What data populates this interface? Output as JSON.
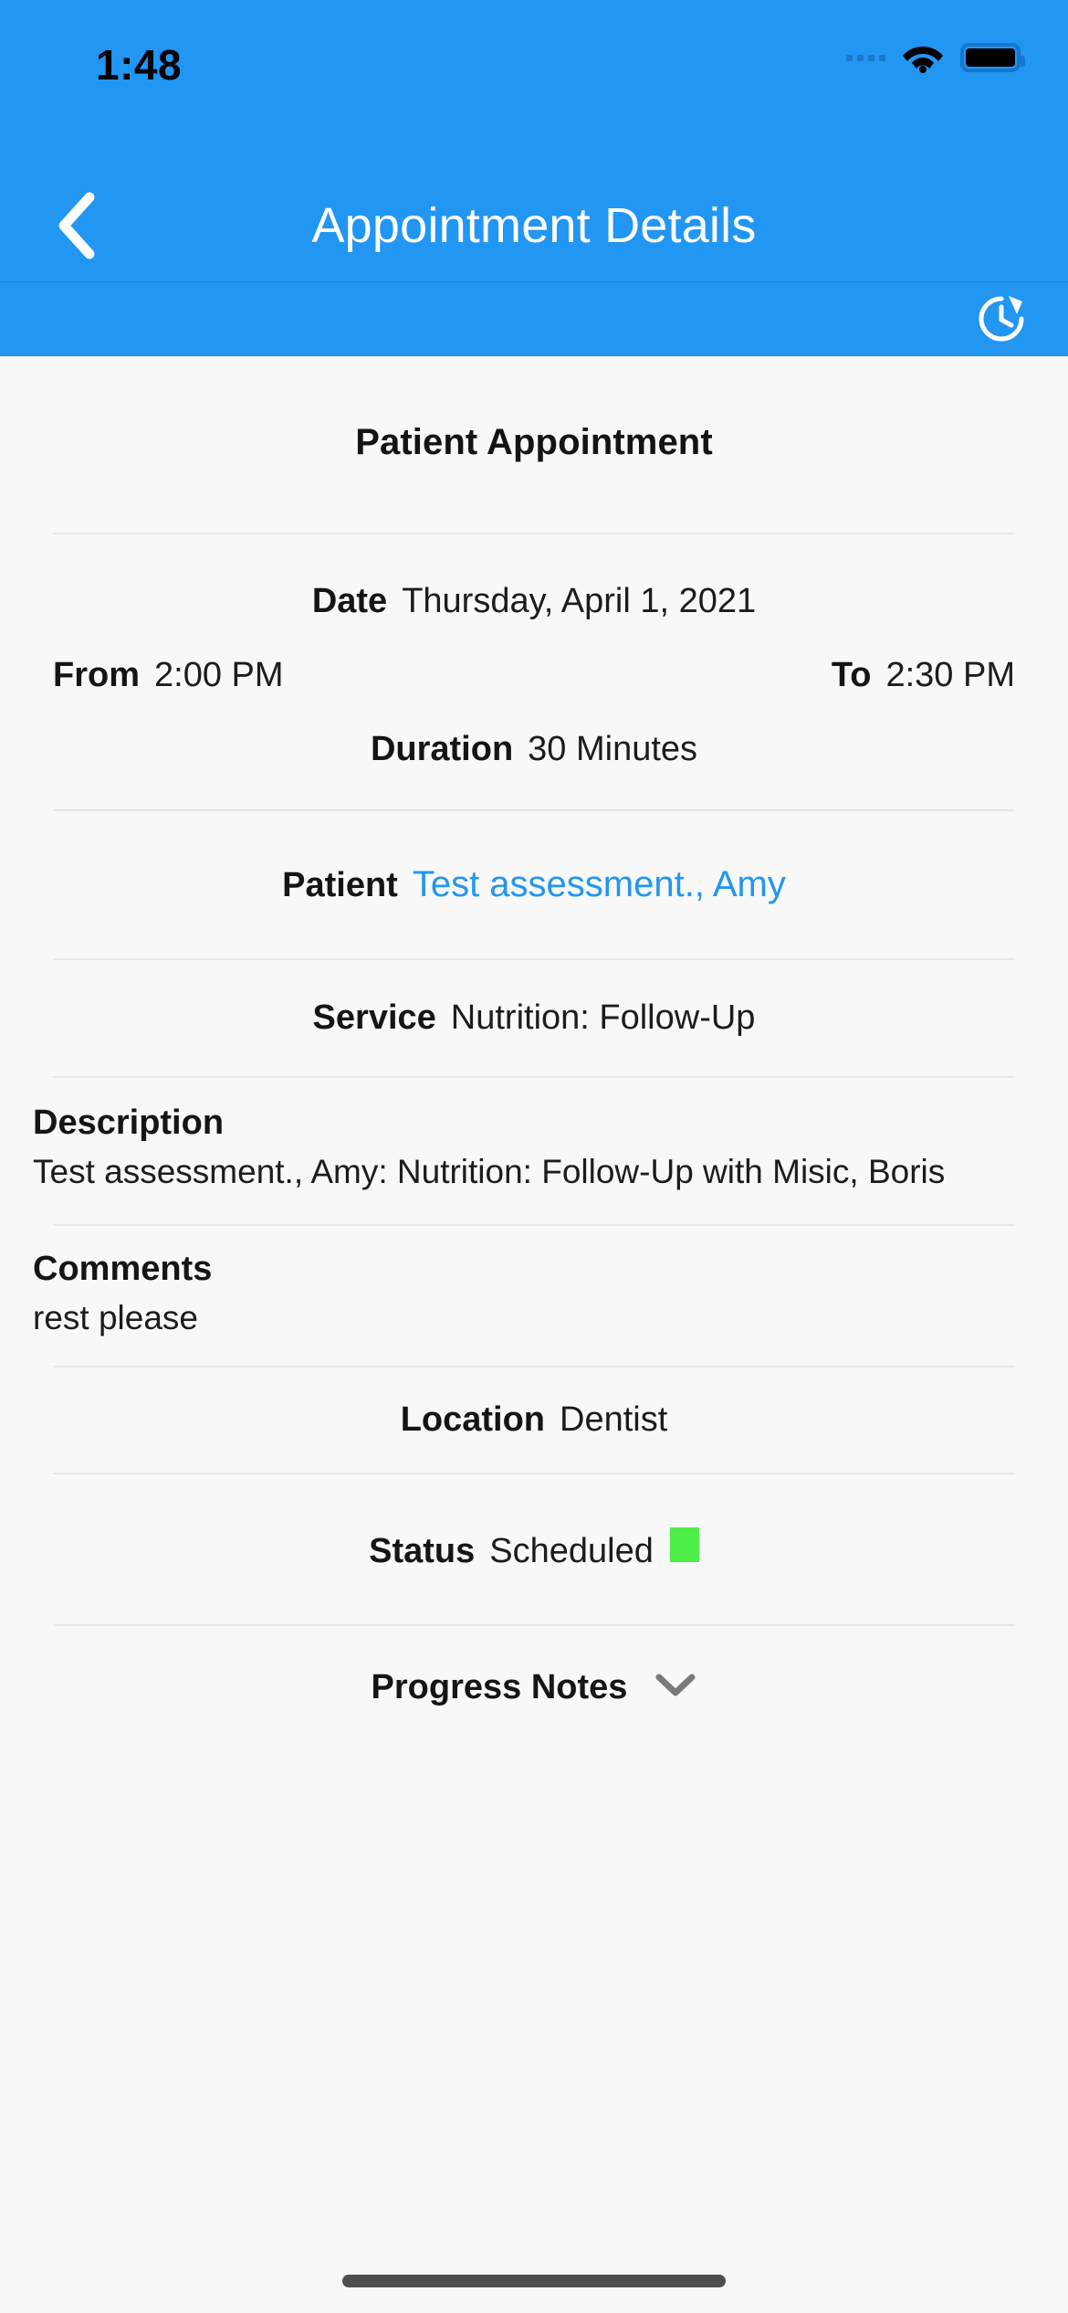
{
  "status_bar": {
    "time": "1:48",
    "icons": [
      "signal-dots-icon",
      "wifi-icon",
      "battery-icon"
    ]
  },
  "nav_bar": {
    "back_icon": "chevron-left-icon",
    "title": "Appointment Details"
  },
  "sub_toolbar": {
    "refresh_icon": "history-refresh-icon"
  },
  "page": {
    "heading": "Patient Appointment",
    "rows": {
      "date_label": "Date",
      "date_value": "Thursday, April 1, 2021",
      "from_label": "From",
      "from_value": "2:00 PM",
      "to_label": "To",
      "to_value": "2:30 PM",
      "duration_label": "Duration",
      "duration_value": "30 Minutes",
      "patient_label": "Patient",
      "patient_value": "Test assessment., Amy",
      "service_label": "Service",
      "service_value": "Nutrition: Follow-Up",
      "description_label": "Description",
      "description_value": "Test assessment., Amy: Nutrition: Follow-Up with Misic, Boris",
      "comments_label": "Comments",
      "comments_value": "rest please",
      "location_label": "Location",
      "location_value": "Dentist",
      "status_label": "Status",
      "status_value": "Scheduled",
      "progress_notes_label": "Progress Notes",
      "progress_notes_icon": "chevron-down-icon"
    }
  },
  "colors": {
    "accent_blue": "#2196F3",
    "link_blue": "#2196F3",
    "status_green": "#4DEE47",
    "background": "#F8F8F8",
    "divider": "#E6E6E6"
  },
  "home_indicator": "home-indicator"
}
